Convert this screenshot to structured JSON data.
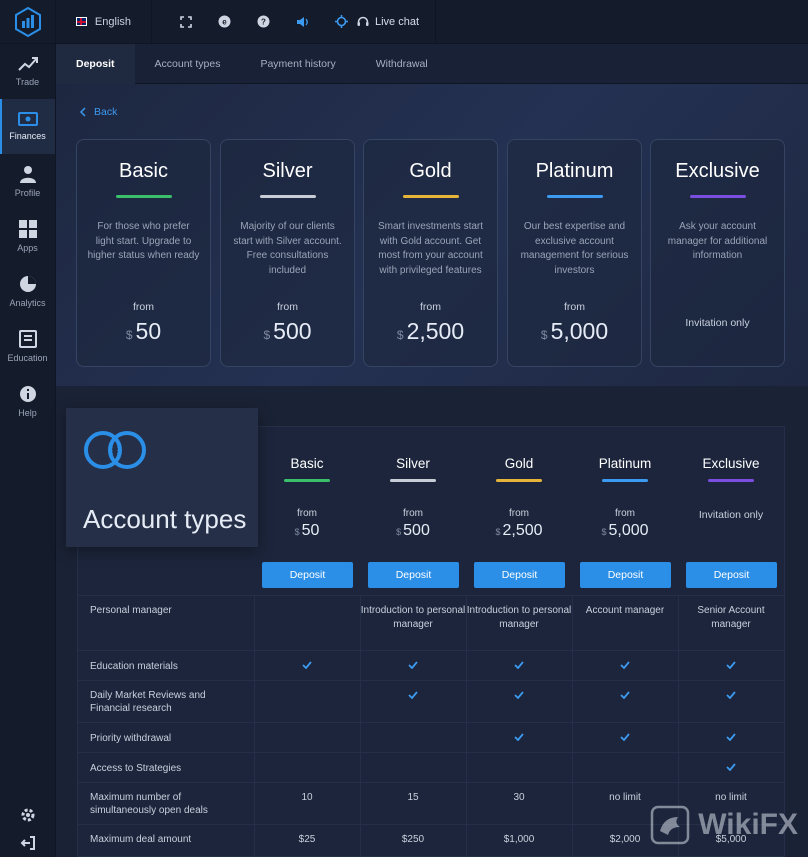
{
  "topbar": {
    "language": "English",
    "live_chat": "Live chat"
  },
  "sidebar": {
    "items": [
      {
        "label": "Trade",
        "icon": "trend-icon"
      },
      {
        "label": "Finances",
        "icon": "wallet-icon"
      },
      {
        "label": "Profile",
        "icon": "user-icon"
      },
      {
        "label": "Apps",
        "icon": "grid-icon"
      },
      {
        "label": "Analytics",
        "icon": "pie-chart-icon"
      },
      {
        "label": "Education",
        "icon": "book-icon"
      },
      {
        "label": "Help",
        "icon": "info-icon"
      }
    ]
  },
  "tabs": [
    "Deposit",
    "Account types",
    "Payment history",
    "Withdrawal"
  ],
  "hero": {
    "back": "Back",
    "cards": [
      {
        "title": "Basic",
        "color": "#3bbf6a",
        "desc": "For those who prefer light start. Upgrade to higher status when ready",
        "from": "from",
        "currency": "$",
        "price": "50"
      },
      {
        "title": "Silver",
        "color": "#c7ccd6",
        "desc": "Majority of our clients start with Silver account. Free consultations included",
        "from": "from",
        "currency": "$",
        "price": "500"
      },
      {
        "title": "Gold",
        "color": "#e7b43a",
        "desc": "Smart investments start with Gold account. Get most from your account with privileged features",
        "from": "from",
        "currency": "$",
        "price": "2,500"
      },
      {
        "title": "Platinum",
        "color": "#3c9af0",
        "desc": "Our best expertise and exclusive account management for serious investors",
        "from": "from",
        "currency": "$",
        "price": "5,000"
      },
      {
        "title": "Exclusive",
        "color": "#7a4fe0",
        "desc": "Ask your account manager for additional information",
        "invite": "Invitation only"
      }
    ]
  },
  "compare": {
    "title": "Account types",
    "deposit_label": "Deposit",
    "columns": [
      {
        "name": "Basic",
        "color": "#3bbf6a",
        "from": "from",
        "currency": "$",
        "price": "50"
      },
      {
        "name": "Silver",
        "color": "#c7ccd6",
        "from": "from",
        "currency": "$",
        "price": "500"
      },
      {
        "name": "Gold",
        "color": "#e7b43a",
        "from": "from",
        "currency": "$",
        "price": "2,500"
      },
      {
        "name": "Platinum",
        "color": "#3c9af0",
        "from": "from",
        "currency": "$",
        "price": "5,000"
      },
      {
        "name": "Exclusive",
        "color": "#7a4fe0",
        "invite": "Invitation only"
      }
    ],
    "rows": [
      {
        "label": "Personal manager",
        "cells": [
          "",
          "Introduction to personal manager",
          "Introduction to personal manager",
          "Account manager",
          "Senior Account manager"
        ]
      },
      {
        "label": "Education materials",
        "cells": [
          "check",
          "check",
          "check",
          "check",
          "check"
        ]
      },
      {
        "label": "Daily Market Reviews and Financial research",
        "cells": [
          "",
          "check",
          "check",
          "check",
          "check"
        ]
      },
      {
        "label": "Priority withdrawal",
        "cells": [
          "",
          "",
          "check",
          "check",
          "check"
        ]
      },
      {
        "label": "Access to Strategies",
        "cells": [
          "",
          "",
          "",
          "",
          "check"
        ]
      },
      {
        "label": "Maximum number of simultaneously open deals",
        "cells": [
          "10",
          "15",
          "30",
          "no limit",
          "no limit"
        ]
      },
      {
        "label": "Maximum deal amount",
        "cells": [
          "$25",
          "$250",
          "$1,000",
          "$2,000",
          "$5,000"
        ]
      }
    ]
  },
  "watermark": "WikiFX"
}
